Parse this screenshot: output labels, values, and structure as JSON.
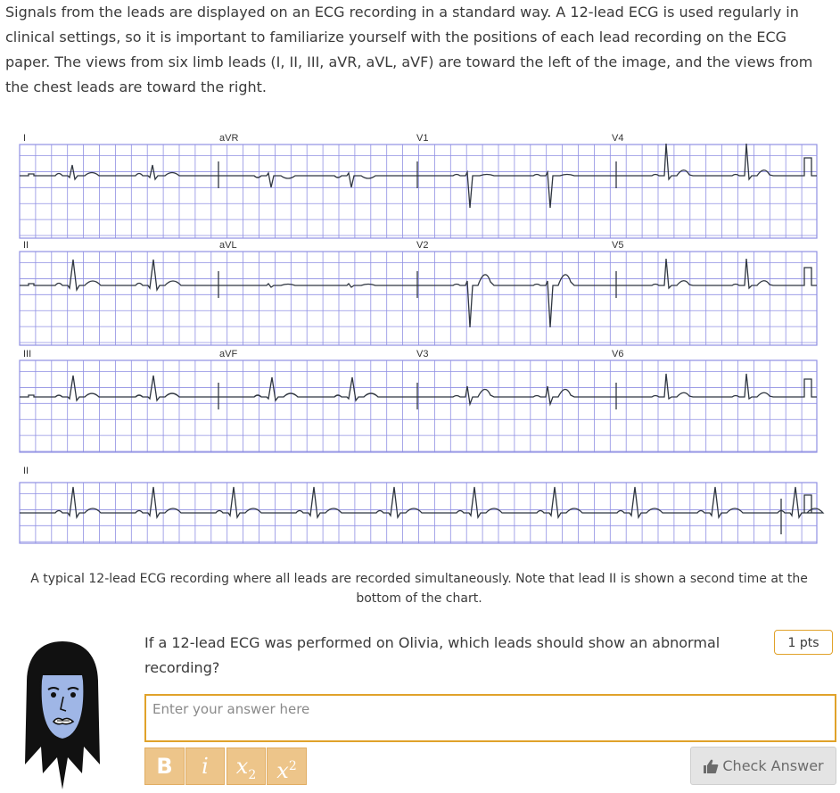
{
  "intro": {
    "text": "Signals from the leads are displayed on an ECG recording in a standard way. A 12-lead ECG is used regularly in clinical settings, so it is important to familiarize yourself with the positions of each lead recording on the ECG paper. The views from six limb leads (I, II, III, aVR, aVL, aVF) are toward the left of the image, and the views from the chest leads are toward the right."
  },
  "ecg": {
    "grid_color": "#8f8fe3",
    "trace_color": "#2f3640",
    "rows": [
      {
        "labels": [
          "I",
          "aVR",
          "V1",
          "V4"
        ]
      },
      {
        "labels": [
          "II",
          "aVL",
          "V2",
          "V5"
        ]
      },
      {
        "labels": [
          "III",
          "aVF",
          "V3",
          "V6"
        ]
      },
      {
        "labels": [
          "II"
        ]
      }
    ]
  },
  "caption": "A typical 12-lead ECG recording where all leads are recorded simultaneously. Note that lead II is shown a second time at the bottom of the chart.",
  "question": {
    "text": "If a 12-lead ECG was performed on Olivia, which leads should show an abnormal recording?",
    "points": "1 pts"
  },
  "answer": {
    "placeholder": "Enter your answer here"
  },
  "toolbar": {
    "bold": "B",
    "italic": "i",
    "sub_base": "x",
    "sub": "2",
    "sup_base": "x",
    "sup": "2"
  },
  "check_button": {
    "label": "Check Answer",
    "icon": "thumbs-up-icon"
  },
  "colors": {
    "accent": "#e0a22a",
    "format_button": "#edc58a",
    "check_bg": "#e4e4e4"
  }
}
